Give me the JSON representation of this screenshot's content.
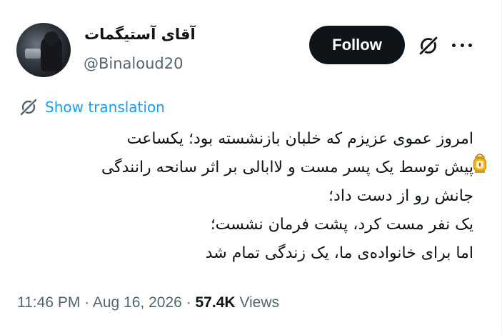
{
  "author": {
    "display_name": "آقای آستیگمات",
    "handle": "@Binaloud20"
  },
  "actions": {
    "follow_label": "Follow"
  },
  "translation": {
    "label": "Show translation"
  },
  "tweet": {
    "lines": [
      "امروز عموی عزیزم که خلبان بازنشسته بود؛ یکساعت",
      "پیش توسط یک پسر مست و لاابالی بر اثر سانحه رانندگی",
      "جانش رو از دست داد؛",
      "یک نفر مست کرد، پشت فرمان نشست؛",
      "اما برای خانواده‌ی ما، یک زندگی تمام شد"
    ]
  },
  "meta": {
    "time": "11:46 PM",
    "separator": "·",
    "date": "Aug 16, 2026",
    "views_count": "57.4K",
    "views_label": "Views"
  },
  "icons": {
    "grok": "grok-icon",
    "more": "more-icon",
    "translate": "translate-icon",
    "lantern": "lantern-emoji-icon"
  },
  "colors": {
    "link": "#1d9bf0",
    "secondary_text": "#536471",
    "primary_text": "#0f1419",
    "button_bg": "#0f1419"
  }
}
